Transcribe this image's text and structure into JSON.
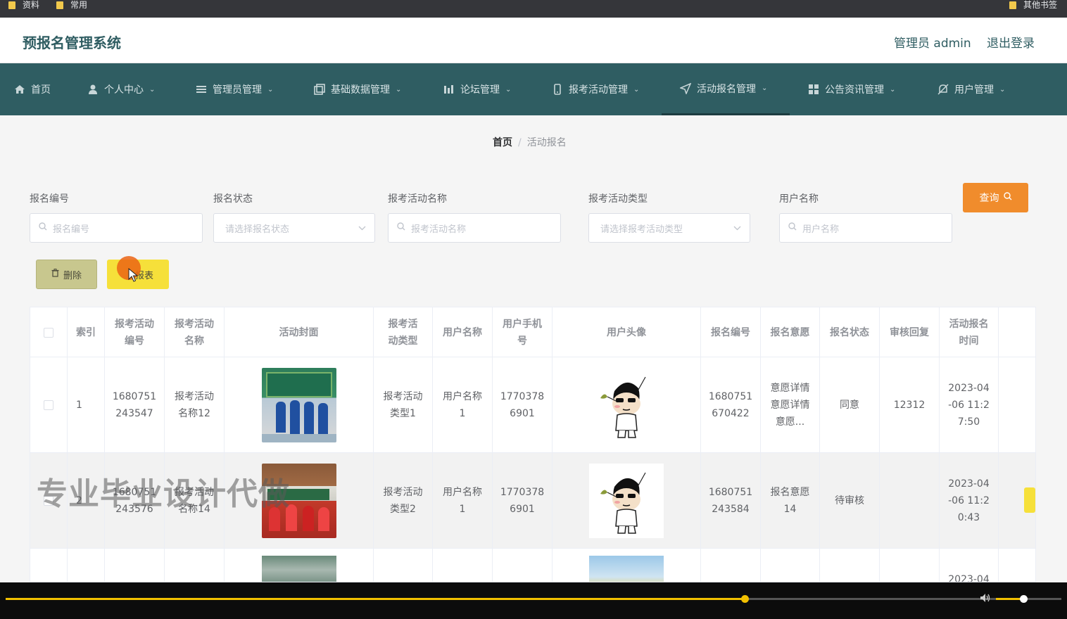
{
  "bookmarks": {
    "items": [
      "资料",
      "常用"
    ],
    "other": "其他书签"
  },
  "header": {
    "title": "预报名管理系统",
    "user": "管理员 admin",
    "logout": "退出登录"
  },
  "nav": {
    "items": [
      {
        "label": "首页",
        "icon": "home-icon"
      },
      {
        "label": "个人中心",
        "icon": "user-icon"
      },
      {
        "label": "管理员管理",
        "icon": "list-icon"
      },
      {
        "label": "基础数据管理",
        "icon": "copy-icon"
      },
      {
        "label": "论坛管理",
        "icon": "chart-icon"
      },
      {
        "label": "报考活动管理",
        "icon": "mobile-icon"
      },
      {
        "label": "活动报名管理",
        "icon": "send-icon"
      },
      {
        "label": "公告资讯管理",
        "icon": "grid-icon"
      },
      {
        "label": "用户管理",
        "icon": "bell-off-icon"
      }
    ],
    "active_index": 6
  },
  "breadcrumb": {
    "home": "首页",
    "current": "活动报名"
  },
  "filters": {
    "enroll_no": {
      "label": "报名编号",
      "placeholder": "报名编号"
    },
    "status": {
      "label": "报名状态",
      "placeholder": "请选择报名状态"
    },
    "activity_name": {
      "label": "报考活动名称",
      "placeholder": "报考活动名称"
    },
    "activity_type": {
      "label": "报考活动类型",
      "placeholder": "请选择报考活动类型"
    },
    "user_name": {
      "label": "用户名称",
      "placeholder": "用户名称"
    },
    "query": "查询"
  },
  "actions": {
    "delete": "删除",
    "report": "报表"
  },
  "table": {
    "columns": [
      "索引",
      "报考活动编号",
      "报考活动名称",
      "活动封面",
      "报考活动类型",
      "用户名称",
      "用户手机号",
      "用户头像",
      "报名编号",
      "报名意愿",
      "报名状态",
      "审核回复",
      "活动报名时间"
    ],
    "rows": [
      {
        "index": "1",
        "activity_no": "1680751243547",
        "activity_name": "报考活动名称12",
        "activity_type": "报考活动类型1",
        "user_name": "用户名称1",
        "phone": "17703786901",
        "enroll_no": "1680751670422",
        "intent": "意愿详情意愿详情意愿...",
        "status": "同意",
        "reply": "12312",
        "time": "2023-04-06 11:27:50"
      },
      {
        "index": "2",
        "activity_no": "1680751243576",
        "activity_name": "报考活动名称14",
        "activity_type": "报考活动类型2",
        "user_name": "用户名称1",
        "phone": "17703786901",
        "enroll_no": "1680751243584",
        "intent": "报名意愿14",
        "status": "待审核",
        "reply": "",
        "time": "2023-04-06 11:20:43"
      },
      {
        "index": "",
        "activity_no": "",
        "activity_name": "",
        "activity_type": "",
        "user_name": "",
        "phone": "",
        "enroll_no": "",
        "intent": "",
        "status": "",
        "reply": "",
        "time": "2023-04"
      }
    ]
  },
  "watermark": "专业毕业设计代做",
  "player": {
    "progress": 0.7,
    "volume": 0.44,
    "accent": "#f2c000"
  },
  "colors": {
    "nav": "#2f5d62",
    "query": "#f08c2c",
    "delete": "#c8c78e",
    "report": "#f6e03a"
  }
}
